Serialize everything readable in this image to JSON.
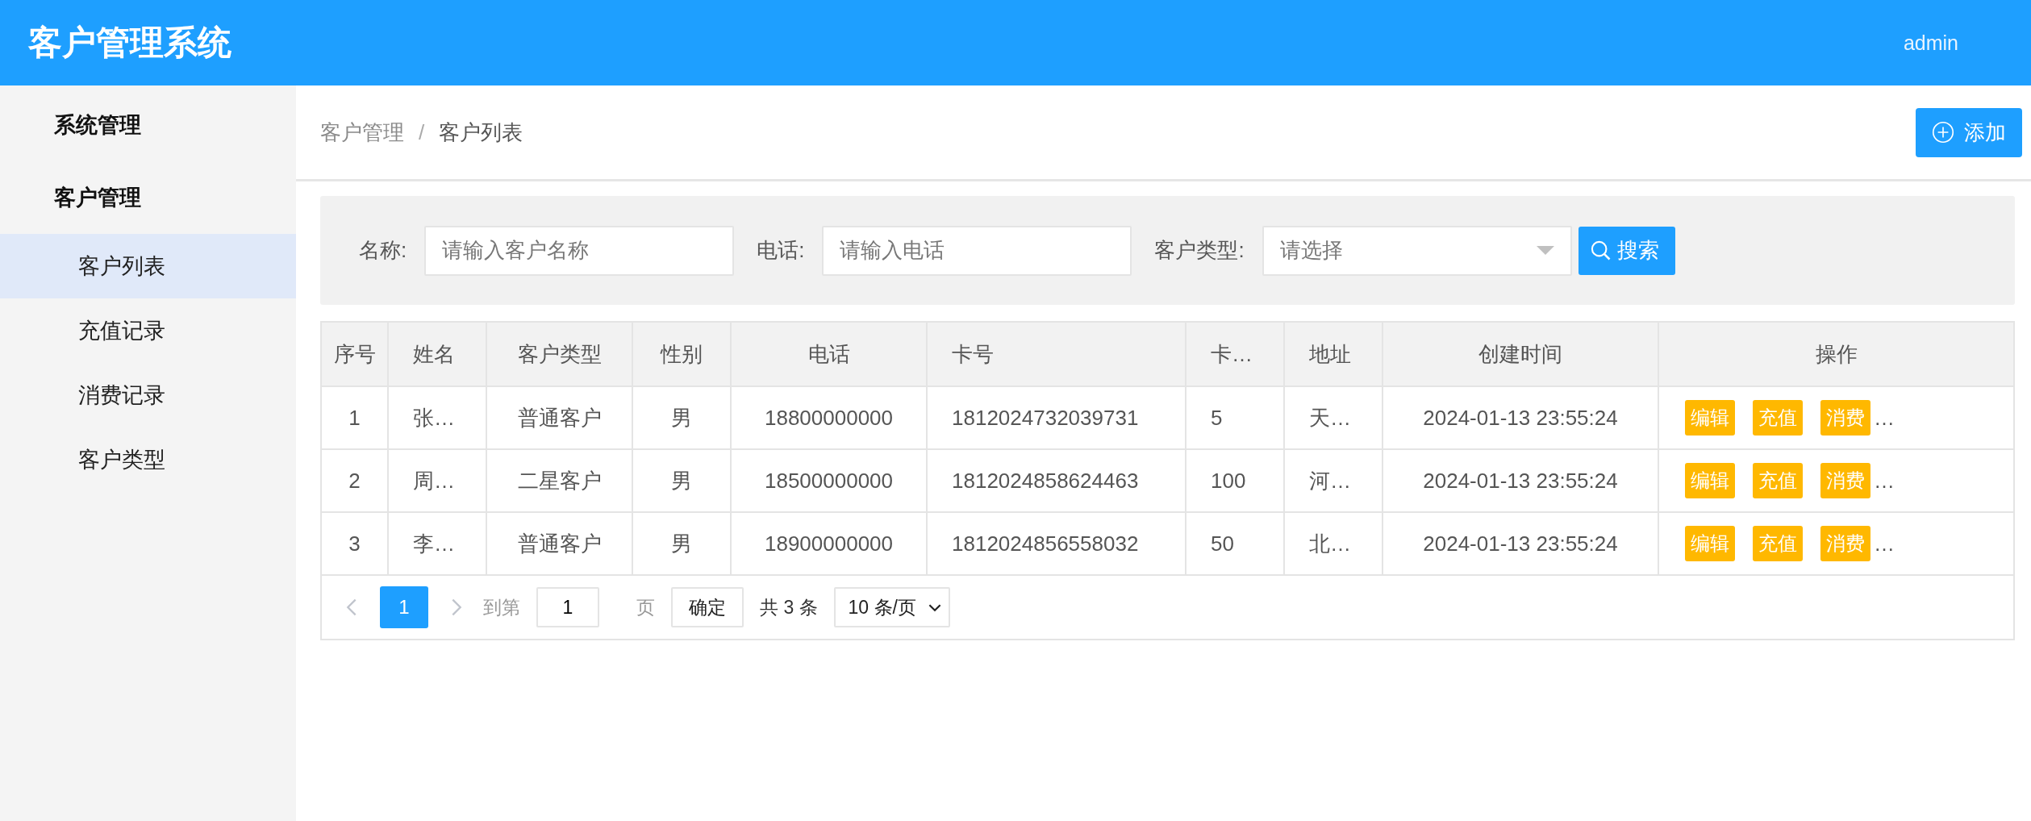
{
  "header": {
    "title": "客户管理系统",
    "user": "admin"
  },
  "sidebar": {
    "groups": [
      {
        "label": "系统管理"
      },
      {
        "label": "客户管理",
        "children": [
          {
            "label": "客户列表",
            "selected": true
          },
          {
            "label": "充值记录",
            "selected": false
          },
          {
            "label": "消费记录",
            "selected": false
          },
          {
            "label": "客户类型",
            "selected": false
          }
        ]
      }
    ]
  },
  "breadcrumb": {
    "items": [
      "客户管理",
      "客户列表"
    ],
    "separator": "/"
  },
  "add_button": "添加",
  "filters": [
    {
      "kind": "input",
      "label": "名称:",
      "placeholder": "请输入客户名称"
    },
    {
      "kind": "input",
      "label": "电话:",
      "placeholder": "请输入电话"
    },
    {
      "kind": "select",
      "label": "客户类型:",
      "placeholder": "请选择"
    }
  ],
  "search_button": "搜索",
  "table": {
    "columns": [
      "序号",
      "姓名",
      "客户类型",
      "性别",
      "电话",
      "卡号",
      "卡…",
      "地址",
      "创建时间",
      "操作"
    ],
    "rows": [
      {
        "cells": [
          "1",
          "张…",
          "普通客户",
          "男",
          "18800000000",
          "1812024732039731",
          "5",
          "天…",
          "2024-01-13 23:55:24"
        ],
        "actions": [
          "编辑",
          "充值",
          "消费"
        ],
        "overflow": "…"
      },
      {
        "cells": [
          "2",
          "周…",
          "二星客户",
          "男",
          "18500000000",
          "1812024858624463",
          "100",
          "河…",
          "2024-01-13 23:55:24"
        ],
        "actions": [
          "编辑",
          "充值",
          "消费"
        ],
        "overflow": "…"
      },
      {
        "cells": [
          "3",
          "李…",
          "普通客户",
          "男",
          "18900000000",
          "1812024856558032",
          "50",
          "北…",
          "2024-01-13 23:55:24"
        ],
        "actions": [
          "编辑",
          "充值",
          "消费"
        ],
        "overflow": "…"
      }
    ]
  },
  "pagination": {
    "pages": [
      {
        "label": "1",
        "selected": true
      }
    ],
    "goto_label": "到第",
    "goto_value": "1",
    "page_unit": "页",
    "confirm": "确定",
    "total": "共 3 条",
    "page_size": "10 条/页"
  }
}
